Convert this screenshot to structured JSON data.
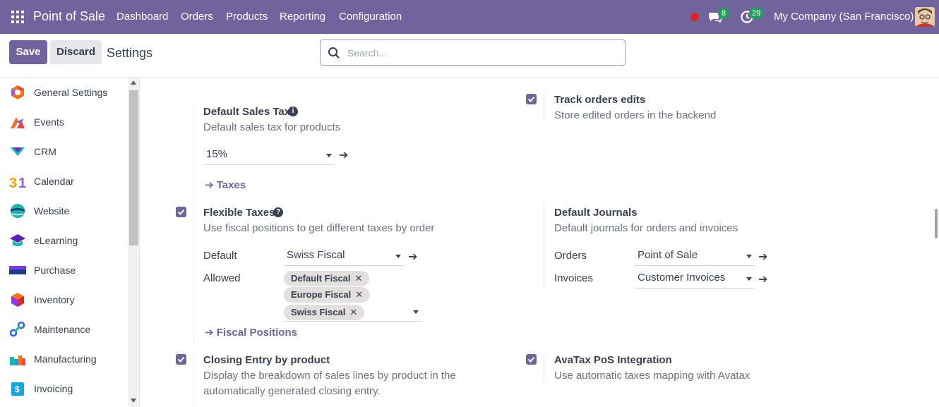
{
  "navbar": {
    "app_name": "Point of Sale",
    "menus": [
      "Dashboard",
      "Orders",
      "Products",
      "Reporting",
      "Configuration"
    ],
    "messages_count": "8",
    "activities_count": "29",
    "company": "My Company (San Francisco)",
    "accent_color": "#71639e"
  },
  "control": {
    "save_label": "Save",
    "discard_label": "Discard",
    "title": "Settings",
    "search_placeholder": "Search..."
  },
  "sidebar": {
    "items": [
      {
        "label": "General Settings",
        "icon": "general-settings-icon"
      },
      {
        "label": "Events",
        "icon": "events-icon"
      },
      {
        "label": "CRM",
        "icon": "crm-icon"
      },
      {
        "label": "Calendar",
        "icon": "calendar-icon"
      },
      {
        "label": "Website",
        "icon": "website-icon"
      },
      {
        "label": "eLearning",
        "icon": "elearning-icon"
      },
      {
        "label": "Purchase",
        "icon": "purchase-icon"
      },
      {
        "label": "Inventory",
        "icon": "inventory-icon"
      },
      {
        "label": "Maintenance",
        "icon": "maintenance-icon"
      },
      {
        "label": "Manufacturing",
        "icon": "manufacturing-icon"
      },
      {
        "label": "Invoicing",
        "icon": "invoicing-icon"
      }
    ]
  },
  "settings": {
    "default_sales_tax": {
      "title": "Default Sales Tax",
      "description": "Default sales tax for products",
      "value": "15%",
      "link": "Taxes"
    },
    "track_orders_edits": {
      "title": "Track orders edits",
      "description": "Store edited orders in the backend",
      "checked": true
    },
    "flexible_taxes": {
      "title": "Flexible Taxes",
      "description": "Use fiscal positions to get different taxes by order",
      "checked": true,
      "default_label": "Default",
      "default_value": "Swiss Fiscal",
      "allowed_label": "Allowed",
      "allowed_tags": [
        "Default Fiscal",
        "Europe Fiscal",
        "Swiss Fiscal"
      ],
      "link": "Fiscal Positions"
    },
    "default_journals": {
      "title": "Default Journals",
      "description": "Default journals for orders and invoices",
      "orders_label": "Orders",
      "orders_value": "Point of Sale",
      "invoices_label": "Invoices",
      "invoices_value": "Customer Invoices"
    },
    "closing_entry": {
      "title": "Closing Entry by product",
      "description_line1": "Display the breakdown of sales lines by product in the",
      "description_line2": "automatically generated closing entry.",
      "checked": true
    },
    "avatax": {
      "title": "AvaTax PoS Integration",
      "description": "Use automatic taxes mapping with Avatax",
      "checked": true
    }
  }
}
